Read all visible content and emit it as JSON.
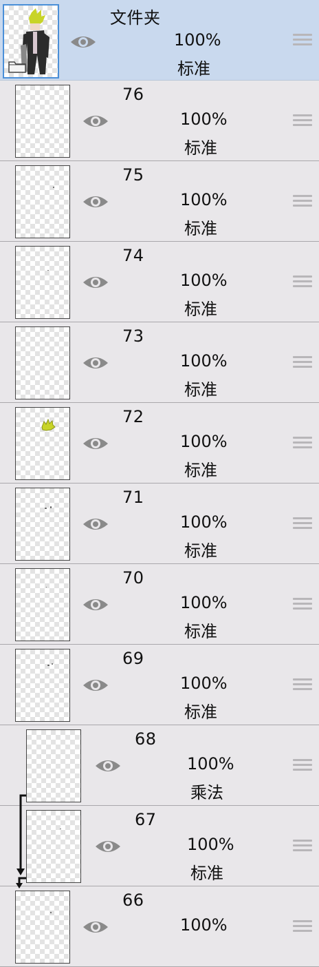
{
  "folder": {
    "name": "文件夹",
    "opacity": "100%",
    "mode": "标准",
    "selected": true
  },
  "layers": [
    {
      "name": "76",
      "opacity": "100%",
      "mode": "标准",
      "clipped": false
    },
    {
      "name": "75",
      "opacity": "100%",
      "mode": "标准",
      "clipped": false
    },
    {
      "name": "74",
      "opacity": "100%",
      "mode": "标准",
      "clipped": false
    },
    {
      "name": "73",
      "opacity": "100%",
      "mode": "标准",
      "clipped": false
    },
    {
      "name": "72",
      "opacity": "100%",
      "mode": "标准",
      "clipped": false
    },
    {
      "name": "71",
      "opacity": "100%",
      "mode": "标准",
      "clipped": false
    },
    {
      "name": "70",
      "opacity": "100%",
      "mode": "标准",
      "clipped": false
    },
    {
      "name": "69",
      "opacity": "100%",
      "mode": "标准",
      "clipped": false
    },
    {
      "name": "68",
      "opacity": "100%",
      "mode": "乘法",
      "clipped": true
    },
    {
      "name": "67",
      "opacity": "100%",
      "mode": "标准",
      "clipped": true
    },
    {
      "name": "66",
      "opacity": "100%",
      "mode": "",
      "clipped": false
    }
  ],
  "icons": {
    "visibility": "eye-icon",
    "reorder": "drag-handle-icon",
    "folder": "folder-icon",
    "clip": "clipping-arrow-icon"
  },
  "colors": {
    "selected_row": "#c9d9ee",
    "row": "#e9e7ea",
    "selection_border": "#4a8fd8",
    "thumbnail_yellow": "#c8d428"
  }
}
